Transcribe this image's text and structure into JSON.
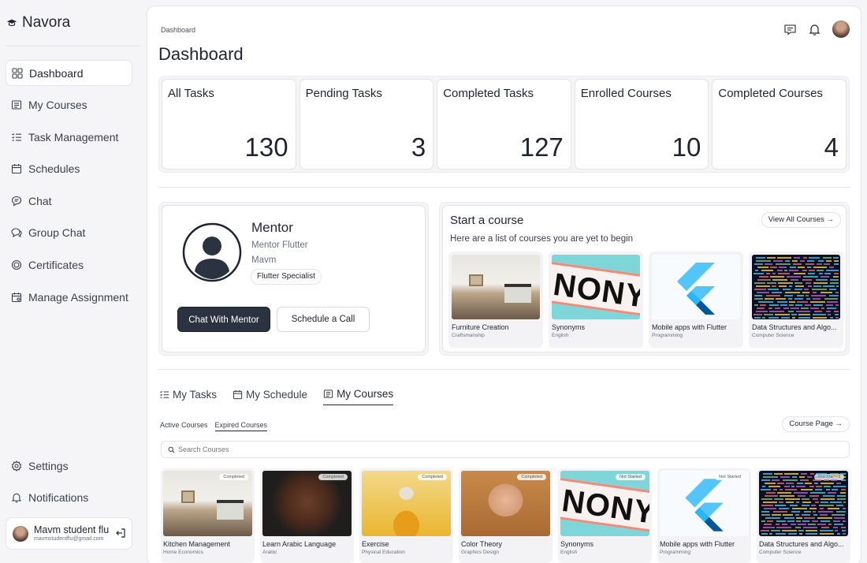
{
  "app": {
    "name": "Navora"
  },
  "sidebar": {
    "items": [
      {
        "label": "Dashboard",
        "icon": "grid-icon",
        "active": true
      },
      {
        "label": "My Courses",
        "icon": "book-icon"
      },
      {
        "label": "Task Management",
        "icon": "checklist-icon"
      },
      {
        "label": "Schedules",
        "icon": "calendar-icon"
      },
      {
        "label": "Chat",
        "icon": "chat-icon"
      },
      {
        "label": "Group Chat",
        "icon": "group-chat-icon"
      },
      {
        "label": "Certificates",
        "icon": "badge-icon"
      },
      {
        "label": "Manage Assignment",
        "icon": "calendar-edit-icon"
      }
    ],
    "bottom": [
      {
        "label": "Settings",
        "icon": "gear-icon"
      },
      {
        "label": "Notifications",
        "icon": "bell-icon"
      }
    ],
    "user": {
      "name": "Mavm student flu",
      "email": "mavmstudentflu@gmail.com"
    }
  },
  "header": {
    "breadcrumb": "Dashboard",
    "title": "Dashboard"
  },
  "stats": [
    {
      "label": "All Tasks",
      "value": "130"
    },
    {
      "label": "Pending Tasks",
      "value": "3"
    },
    {
      "label": "Completed Tasks",
      "value": "127"
    },
    {
      "label": "Enrolled Courses",
      "value": "10"
    },
    {
      "label": "Completed Courses",
      "value": "4"
    }
  ],
  "mentor": {
    "title": "Mentor",
    "role": "Mentor Flutter",
    "org": "Mavm",
    "tag": "Flutter Specialist",
    "chat_label": "Chat With Mentor",
    "schedule_label": "Schedule a Call"
  },
  "start_course": {
    "title": "Start a course",
    "subtitle": "Here are a list of courses you are yet to begin",
    "view_all": "View All Courses →",
    "courses": [
      {
        "name": "Furniture Creation",
        "category": "Craftsmanship",
        "image": "kitchen"
      },
      {
        "name": "Synonyms",
        "category": "English",
        "image": "nony"
      },
      {
        "name": "Mobile apps with Flutter",
        "category": "Programming",
        "image": "flutter"
      },
      {
        "name": "Data Structures and Algo...",
        "category": "Computer Science",
        "image": "code"
      }
    ]
  },
  "tabs": [
    {
      "label": "My Tasks",
      "icon": "checklist-icon"
    },
    {
      "label": "My Schedule",
      "icon": "calendar-icon"
    },
    {
      "label": "My Courses",
      "icon": "book-icon",
      "active": true
    }
  ],
  "course_tabs": {
    "active_label": "Active Courses",
    "expired_label": "Expired Courses",
    "course_page": "Course Page →",
    "search_placeholder": "Search Courses"
  },
  "my_courses": [
    {
      "name": "Kitchen Management",
      "category": "Home Economics",
      "status": "Completed",
      "image": "kitchen"
    },
    {
      "name": "Learn Arabic Language",
      "category": "Arabic",
      "status": "Completed",
      "image": "face1"
    },
    {
      "name": "Exercise",
      "category": "Physical Education",
      "status": "Completed",
      "image": "face2"
    },
    {
      "name": "Color Theory",
      "category": "Graphics Design",
      "status": "Completed",
      "image": "face3"
    },
    {
      "name": "Synonyms",
      "category": "English",
      "status": "Not Started",
      "image": "nony"
    },
    {
      "name": "Mobile apps with Flutter",
      "category": "Programming",
      "status": "Not Started",
      "image": "flutter"
    },
    {
      "name": "Data Structures and Algo...",
      "category": "Computer Science",
      "status": "Not Started",
      "image": "code"
    }
  ],
  "nony_text": "NONY",
  "colors": {
    "primary_dark": "#2c3340",
    "flutter_light": "#54c5f8",
    "flutter_dark": "#01579b"
  }
}
